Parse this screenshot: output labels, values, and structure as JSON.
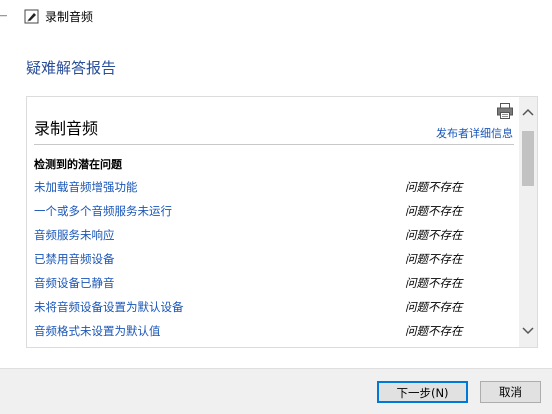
{
  "window": {
    "title": "录制音频"
  },
  "page": {
    "heading": "疑难解答报告"
  },
  "report": {
    "section_title": "录制音频",
    "publisher_link": "发布者详细信息",
    "issues_header": "检测到的潜在问题",
    "issues": [
      {
        "name": "未加载音频增强功能",
        "status": "问题不存在"
      },
      {
        "name": "一个或多个音频服务未运行",
        "status": "问题不存在"
      },
      {
        "name": "音频服务未响应",
        "status": "问题不存在"
      },
      {
        "name": "已禁用音频设备",
        "status": "问题不存在"
      },
      {
        "name": "音频设备已静音",
        "status": "问题不存在"
      },
      {
        "name": "未将音频设备设置为默认设备",
        "status": "问题不存在"
      },
      {
        "name": "音频格式未设置为默认值",
        "status": "问题不存在"
      }
    ]
  },
  "footer": {
    "next_label": "下一步(N)",
    "cancel_label": "取消"
  },
  "icons": {
    "back": "back-arrow-icon",
    "app": "audio-troubleshooter-icon",
    "print": "printer-icon",
    "scroll_up": "chevron-up-icon",
    "scroll_down": "chevron-down-icon"
  },
  "colors": {
    "heading": "#2a4e9a",
    "link": "#1a56b8",
    "primary_button_border": "#0078d7",
    "footer_bg": "#f0f0f0"
  }
}
